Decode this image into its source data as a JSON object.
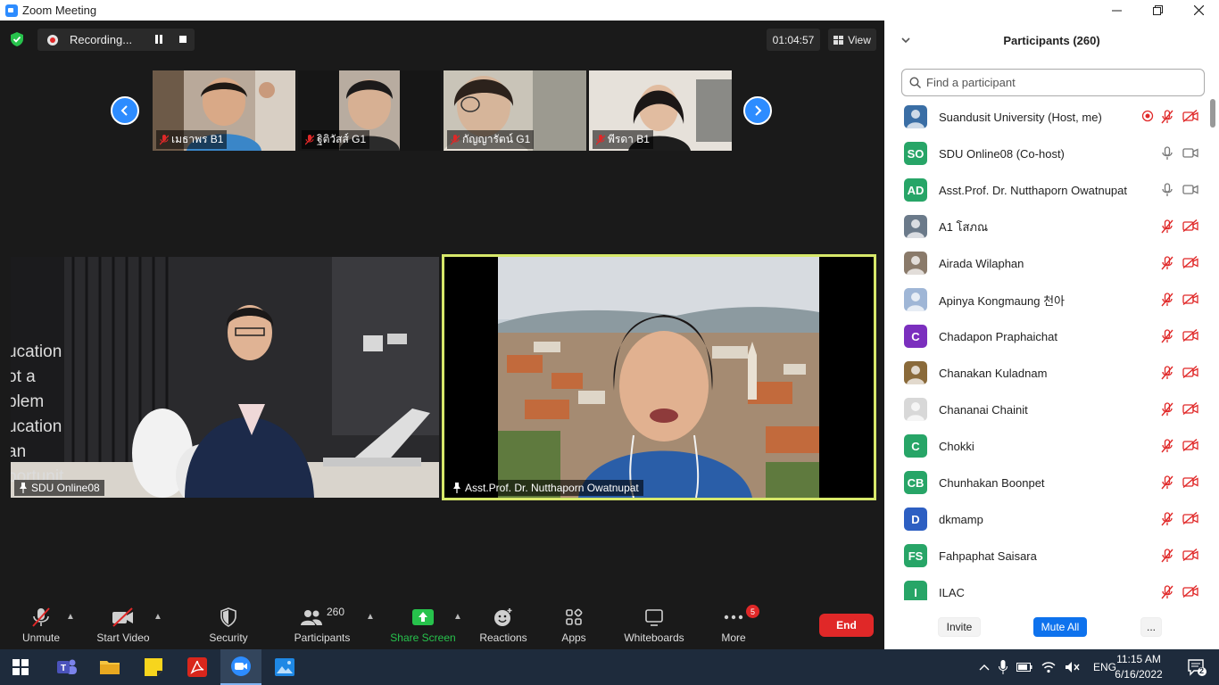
{
  "window": {
    "title": "Zoom Meeting"
  },
  "top_bar": {
    "recording_label": "Recording...",
    "timer": "01:04:57",
    "view_label": "View"
  },
  "thumbnails": [
    {
      "name": "เมธาพร B1"
    },
    {
      "name": "ฐิติวัสส์ G1"
    },
    {
      "name": "กัญญารัตน์ G1"
    },
    {
      "name": "พีรดา B1"
    }
  ],
  "main_tiles": [
    {
      "name": "SDU Online08"
    },
    {
      "name": "Asst.Prof. Dr. Nutthaporn Owatnupat"
    }
  ],
  "toolbar": {
    "unmute": "Unmute",
    "start_video": "Start Video",
    "security": "Security",
    "participants": "Participants",
    "participants_count": "260",
    "share_screen": "Share Screen",
    "reactions": "Reactions",
    "apps": "Apps",
    "whiteboards": "Whiteboards",
    "more": "More",
    "more_badge": "5",
    "end": "End"
  },
  "panel": {
    "title": "Participants (260)",
    "search_placeholder": "Find a participant",
    "participants": [
      {
        "name": "Suandusit University (Host, me)",
        "initials": "",
        "color": "#3a6ea5"
      },
      {
        "name": "SDU Online08 (Co-host)",
        "initials": "SO",
        "color": "#27a567"
      },
      {
        "name": "Asst.Prof. Dr. Nutthaporn Owatnupat",
        "initials": "AD",
        "color": "#27a567"
      },
      {
        "name": "A1 โสภณ",
        "initials": "",
        "color": "#6b7a8a"
      },
      {
        "name": "Airada Wilaphan",
        "initials": "",
        "color": "#8a7a6a"
      },
      {
        "name": "Apinya Kongmaung 천아",
        "initials": "",
        "color": "#9fb6d6"
      },
      {
        "name": "Chadapon Praphaichat",
        "initials": "C",
        "color": "#7b2fbe"
      },
      {
        "name": "Chanakan Kuladnam",
        "initials": "",
        "color": "#8a6a3a"
      },
      {
        "name": "Chananai Chainit",
        "initials": "",
        "color": "#d8d8d8"
      },
      {
        "name": "Chokki",
        "initials": "C",
        "color": "#27a567"
      },
      {
        "name": "Chunhakan Boonpet",
        "initials": "CB",
        "color": "#27a567"
      },
      {
        "name": "dkmamp",
        "initials": "D",
        "color": "#2d5fc2"
      },
      {
        "name": "Fahpaphat Saisara",
        "initials": "FS",
        "color": "#27a567"
      },
      {
        "name": "ILAC",
        "initials": "I",
        "color": "#27a567"
      }
    ],
    "invite": "Invite",
    "mute_all": "Mute All",
    "more": "..."
  },
  "taskbar": {
    "language": "ENG",
    "time": "11:15 AM",
    "date": "6/16/2022",
    "notifications": "2"
  }
}
